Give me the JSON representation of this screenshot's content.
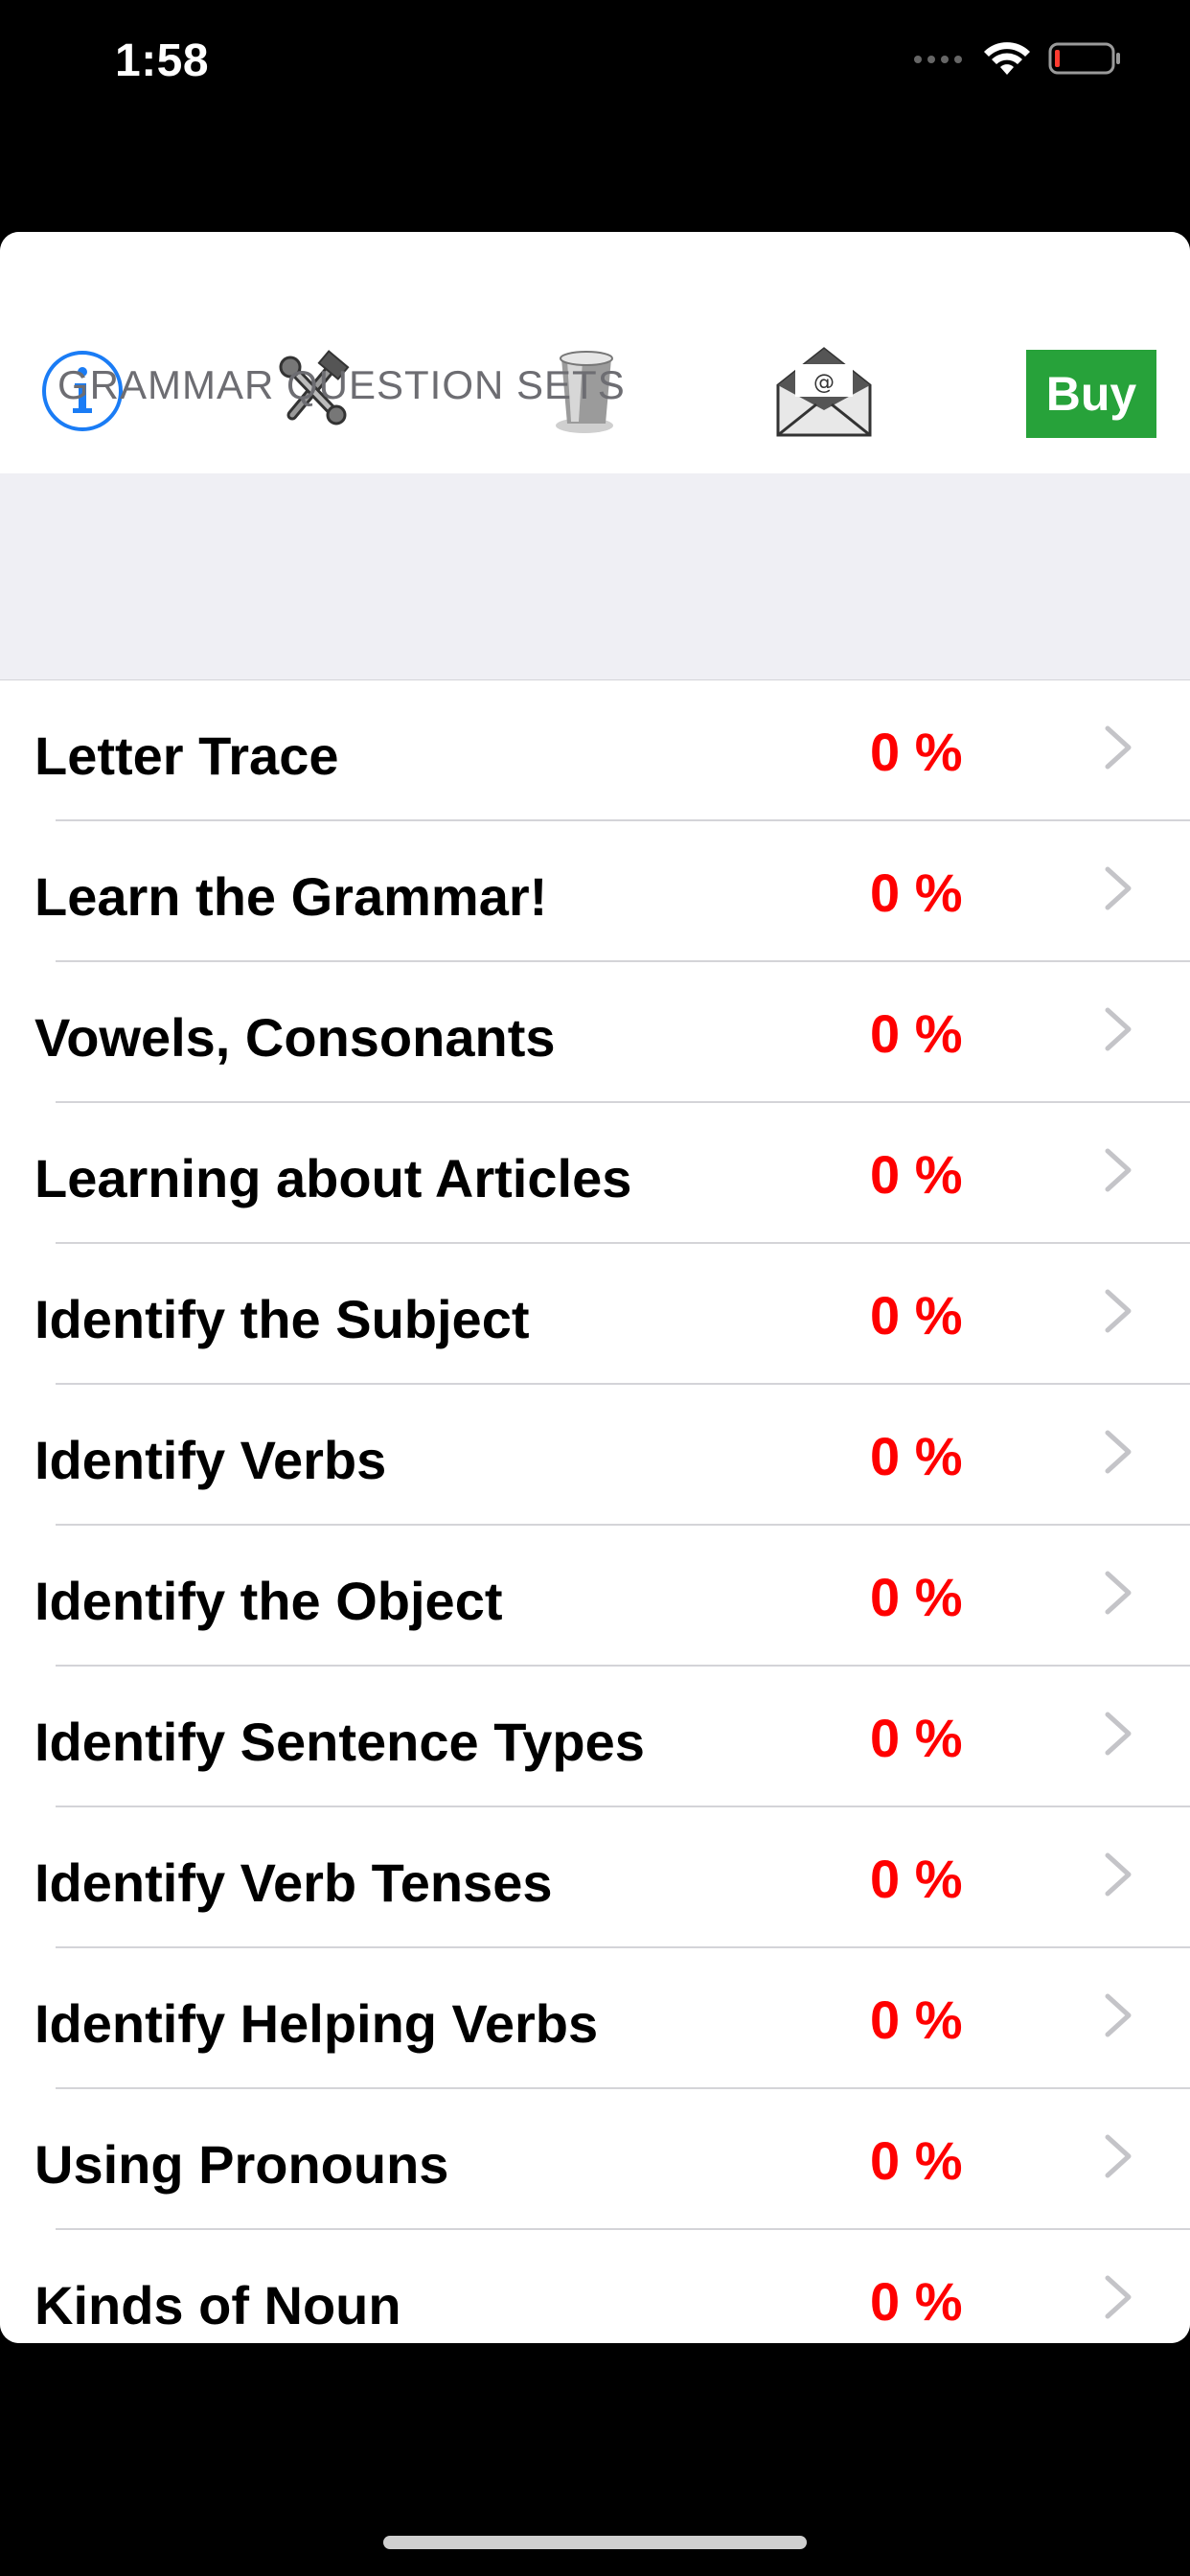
{
  "status": {
    "time": "1:58"
  },
  "toolbar": {
    "info_icon": "info-circle-icon",
    "tools_icon": "wrench-hammer-icon",
    "trash_icon": "trash-can-icon",
    "mail_icon": "email-envelope-icon",
    "buy_label": "Buy"
  },
  "section": {
    "title": "GRAMMAR QUESTION SETS"
  },
  "items": [
    {
      "label": "Letter Trace",
      "percent": "0 %"
    },
    {
      "label": "Learn the Grammar!",
      "percent": "0 %"
    },
    {
      "label": "Vowels, Consonants",
      "percent": "0 %"
    },
    {
      "label": "Learning about Articles",
      "percent": "0 %"
    },
    {
      "label": "Identify the Subject",
      "percent": "0 %"
    },
    {
      "label": "Identify Verbs",
      "percent": "0 %"
    },
    {
      "label": "Identify the Object",
      "percent": "0 %"
    },
    {
      "label": "Identify Sentence Types",
      "percent": "0 %"
    },
    {
      "label": "Identify Verb Tenses",
      "percent": "0 %"
    },
    {
      "label": "Identify Helping Verbs",
      "percent": "0 %"
    },
    {
      "label": "Using Pronouns",
      "percent": "0 %"
    },
    {
      "label": "Kinds of Noun",
      "percent": "0 %"
    }
  ],
  "colors": {
    "accent": "#1a7cf5",
    "percent": "#ff0000",
    "buy": "#27a23a"
  }
}
